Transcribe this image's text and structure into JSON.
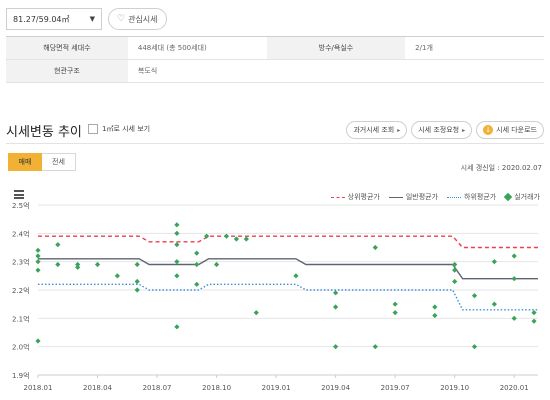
{
  "header": {
    "area_select": "81.27/59.04㎡",
    "favorite_label": "관심시세"
  },
  "info": {
    "rows": [
      {
        "h1": "해당면적 세대수",
        "v1": "448세대 (총 500세대)",
        "h2": "방수/욕실수",
        "v2": "2/1개"
      },
      {
        "h1": "현관구조",
        "v1": "복도식",
        "h2": "",
        "v2": ""
      }
    ]
  },
  "section": {
    "title": "시세변동 추이",
    "checkbox_label": "1㎡로 시세 보기",
    "buttons": [
      "과거시세 조회",
      "시세 조정요청",
      "시세 다운로드"
    ]
  },
  "tabs": [
    {
      "label": "매매",
      "active": true
    },
    {
      "label": "전세",
      "active": false
    }
  ],
  "updated": "시세 갱신일 : 2020.02.07",
  "colors": {
    "upper": "#e8414f",
    "avg": "#5d6670",
    "lower": "#3a8ddc",
    "deal": "#3aa35a",
    "accent": "#f0b135"
  },
  "chart_data": {
    "type": "line",
    "y_tick_labels": [
      "1.9억",
      "2.0억",
      "2.1억",
      "2.2억",
      "2.3억",
      "2.4억",
      "2.5억"
    ],
    "ylim": [
      1.9,
      2.5
    ],
    "x_tick_labels": [
      "2018.01",
      "2018.04",
      "2018.07",
      "2018.10",
      "2019.01",
      "2019.04",
      "2019.07",
      "2019.10",
      "2020.01"
    ],
    "xlim": [
      0,
      25.2
    ],
    "series": [
      {
        "name": "상위평균가",
        "style": "dashed",
        "color": "#e8414f",
        "points": [
          [
            0,
            2.39
          ],
          [
            5.1,
            2.39
          ],
          [
            5.6,
            2.37
          ],
          [
            8.1,
            2.37
          ],
          [
            8.6,
            2.39
          ],
          [
            20.9,
            2.39
          ],
          [
            21.4,
            2.35
          ],
          [
            25.2,
            2.35
          ]
        ]
      },
      {
        "name": "일반평균가",
        "style": "solid",
        "color": "#5d6670",
        "points": [
          [
            0,
            2.31
          ],
          [
            5.1,
            2.31
          ],
          [
            5.6,
            2.29
          ],
          [
            8.1,
            2.29
          ],
          [
            8.6,
            2.31
          ],
          [
            13.0,
            2.31
          ],
          [
            13.5,
            2.29
          ],
          [
            20.9,
            2.29
          ],
          [
            21.4,
            2.24
          ],
          [
            25.2,
            2.24
          ]
        ]
      },
      {
        "name": "하위평균가",
        "style": "dotted",
        "color": "#3a8ddc",
        "points": [
          [
            0,
            2.22
          ],
          [
            5.1,
            2.22
          ],
          [
            5.6,
            2.2
          ],
          [
            8.1,
            2.2
          ],
          [
            8.6,
            2.22
          ],
          [
            13.0,
            2.22
          ],
          [
            13.5,
            2.2
          ],
          [
            20.9,
            2.2
          ],
          [
            21.4,
            2.13
          ],
          [
            25.2,
            2.13
          ]
        ]
      }
    ],
    "scatter": {
      "name": "실거래가",
      "color": "#3aa35a",
      "points": [
        [
          0.0,
          2.34
        ],
        [
          0.0,
          2.32
        ],
        [
          0.0,
          2.3
        ],
        [
          0.0,
          2.27
        ],
        [
          0.0,
          2.02
        ],
        [
          1.0,
          2.36
        ],
        [
          1.0,
          2.29
        ],
        [
          2.0,
          2.29
        ],
        [
          2.0,
          2.28
        ],
        [
          3.0,
          2.29
        ],
        [
          4.0,
          2.25
        ],
        [
          5.0,
          2.29
        ],
        [
          5.0,
          2.23
        ],
        [
          5.0,
          2.2
        ],
        [
          7.0,
          2.43
        ],
        [
          7.0,
          2.4
        ],
        [
          7.0,
          2.36
        ],
        [
          7.0,
          2.3
        ],
        [
          7.0,
          2.25
        ],
        [
          7.0,
          2.07
        ],
        [
          8.0,
          2.33
        ],
        [
          8.0,
          2.29
        ],
        [
          8.0,
          2.22
        ],
        [
          8.5,
          2.39
        ],
        [
          9.0,
          2.29
        ],
        [
          9.5,
          2.39
        ],
        [
          10.0,
          2.38
        ],
        [
          10.5,
          2.38
        ],
        [
          11.0,
          2.12
        ],
        [
          13.0,
          2.25
        ],
        [
          15.0,
          2.19
        ],
        [
          15.0,
          2.14
        ],
        [
          15.0,
          2.0
        ],
        [
          17.0,
          2.35
        ],
        [
          17.0,
          2.0
        ],
        [
          18.0,
          2.15
        ],
        [
          18.0,
          2.12
        ],
        [
          20.0,
          2.14
        ],
        [
          20.0,
          2.11
        ],
        [
          21.0,
          2.29
        ],
        [
          21.0,
          2.27
        ],
        [
          21.0,
          2.23
        ],
        [
          22.0,
          2.18
        ],
        [
          22.0,
          2.0
        ],
        [
          23.0,
          2.3
        ],
        [
          23.0,
          2.15
        ],
        [
          24.0,
          2.32
        ],
        [
          24.0,
          2.24
        ],
        [
          24.0,
          2.1
        ],
        [
          25.0,
          2.12
        ],
        [
          25.0,
          2.09
        ]
      ]
    }
  }
}
